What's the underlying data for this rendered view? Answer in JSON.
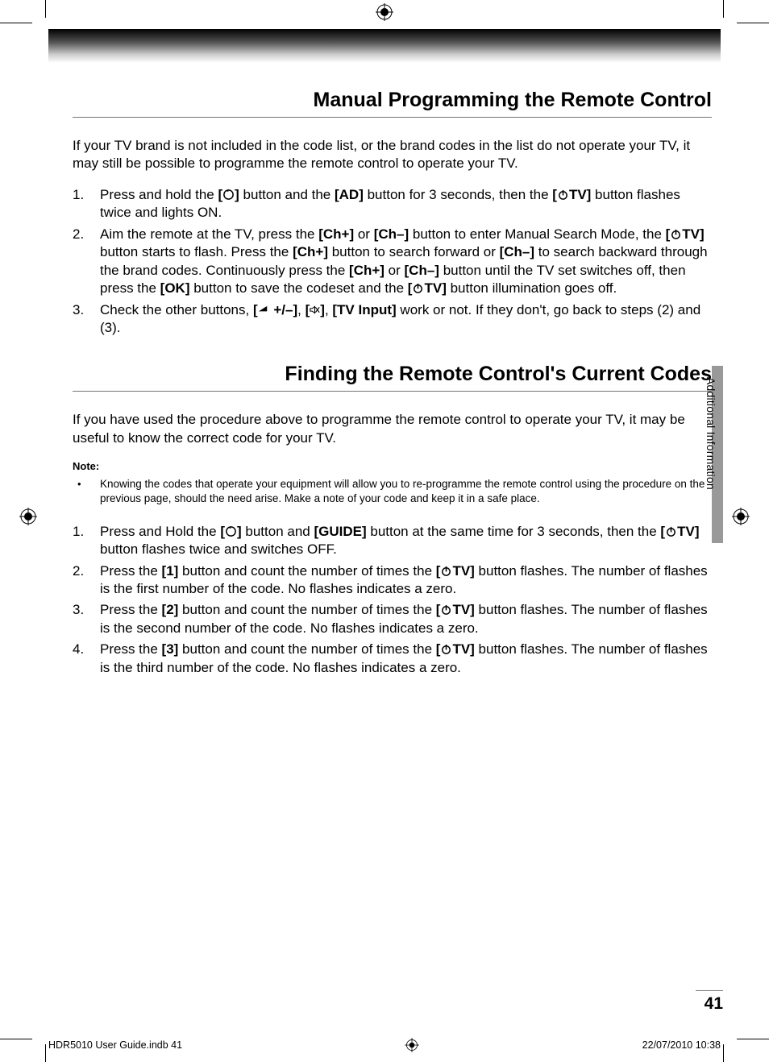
{
  "section1": {
    "title": "Manual Programming the Remote Control",
    "intro": "If your TV brand is not included in the code list, or the brand codes in the list do not operate your TV, it may still be possible to programme the remote control to operate your TV.",
    "step1_a": "Press and hold the ",
    "step1_b": " button and the ",
    "step1_ad": "[AD]",
    "step1_c": " button for 3 seconds, then the ",
    "step1_d": " button flashes twice and lights ON.",
    "step2_a": "Aim the remote at the TV, press the ",
    "step2_chp": "[Ch+]",
    "step2_or": " or ",
    "step2_chm": "[Ch–]",
    "step2_b": " button to enter Manual Search Mode, the ",
    "step2_c": " button starts to flash. Press the ",
    "step2_d": " button to search forward or ",
    "step2_e": " to search backward through the brand codes. Continuously press the ",
    "step2_f": " or ",
    "step2_g": " button until the TV set switches off, then press the ",
    "step2_ok": "[OK]",
    "step2_h": " button to save the codeset and the ",
    "step2_i": " button illumination goes off.",
    "step3_a": "Check the other buttons, ",
    "step3_b": ", ",
    "step3_tvin": "[TV Input]",
    "step3_c": " work or not. If they don't, go back to steps (2) and (3)."
  },
  "section2": {
    "title": "Finding the Remote Control's Current Codes",
    "intro": "If you have used the procedure above to programme the remote control to operate your TV, it may be useful to know the correct code for your TV.",
    "note_label": "Note:",
    "note_body": "Knowing the codes that operate your equipment will allow you to re-programme the remote control using the procedure on the previous page, should the need arise. Make a note of your code and keep it in a safe place.",
    "step1_a": "Press and Hold the ",
    "step1_b": " button and ",
    "step1_guide": "[GUIDE]",
    "step1_c": " button at the same time for 3 seconds, then the ",
    "step1_d": " button flashes twice and switches OFF.",
    "step2_a": "Press the ",
    "step2_one": "[1]",
    "step2_b": " button and count the number of times the ",
    "step2_c": " button flashes. The number of flashes is the first number of the code. No flashes indicates a zero.",
    "step3_a": "Press the ",
    "step3_two": "[2]",
    "step3_b": " button and count the number of times the ",
    "step3_c": " button flashes. The number of flashes is the second number of the code. No flashes indicates a zero.",
    "step4_a": "Press the ",
    "step4_three": "[3]",
    "step4_b": " button and count the number of times the ",
    "step4_c": " button flashes. The number of flashes is the third number of the code. No flashes indicates a zero."
  },
  "labels": {
    "circle_open": "[",
    "circle_close": "]",
    "power_tv_open": "[",
    "power_tv_mid": "TV]",
    "vol_pm": "+/–]",
    "vol_open": "[",
    "mute_open": "[",
    "mute_close": "]"
  },
  "sidetab": "Additional Information",
  "page_number": "41",
  "footer_left": "HDR5010 User Guide.indb   41",
  "footer_right": "22/07/2010   10:38"
}
